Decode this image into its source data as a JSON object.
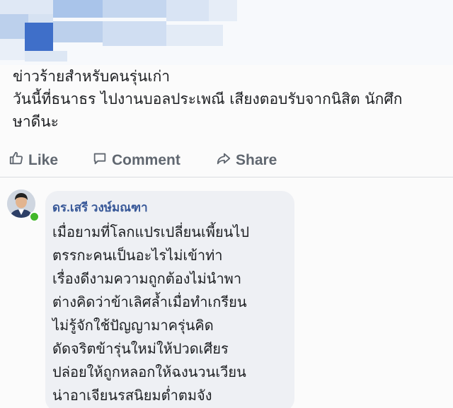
{
  "post": {
    "lines": [
      "ข่าวร้ายสำหรับคนรุ่นเก่า",
      "วันนี้ที่ธนาธร ไปงานบอลประเพณี เสียงตอบรับจากนิสิต นักศึก",
      "ษาดีนะ"
    ]
  },
  "actions": {
    "like": "Like",
    "comment": "Comment",
    "share": "Share"
  },
  "comment": {
    "author": "ดร.เสรี วงษ์มณฑา",
    "lines": [
      "เมื่อยามที่โลกแปรเปลี่ยนเพี้ยนไป",
      "ตรรกะคนเป็นอะไรไม่เข้าท่า",
      "เรื่องดีงามความถูกต้องไม่นำพา",
      "ต่างคิดว่าข้าเลิศล้ำเมื่อทำเกรียน",
      "ไม่รู้จักใช้ปัญญามาครุ่นคิด",
      "ดัดจริตข้ารุ่นใหม่ให้ปวดเศียร",
      "ปล่อยให้ถูกหลอกให้ฉงนวนเวียน",
      "น่าอาเจียนรสนิยมต่ำตมจัง"
    ]
  },
  "colors": {
    "link": "#385898",
    "action_text": "#606770",
    "bubble": "#eef0f4",
    "online": "#42b72a"
  },
  "icons": {
    "like": "thumbs-up-icon",
    "comment": "comment-icon",
    "share": "share-icon"
  }
}
